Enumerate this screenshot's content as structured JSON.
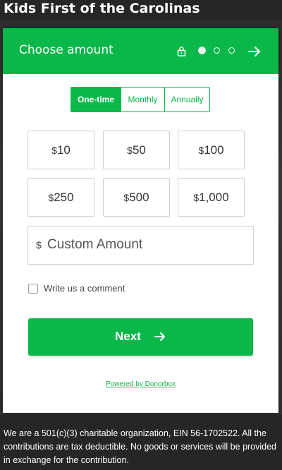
{
  "page": {
    "title": "Kids First of the Carolinas",
    "footer": "We are a 501(c)(3) charitable organization, EIN 56-1702522. All the contributions are tax deductible. No goods or services will be provided in exchange for the contribution."
  },
  "widget": {
    "header_title": "Choose amount",
    "steps_total": 3,
    "current_step": 1,
    "icons": {
      "lock": "lock-icon",
      "next": "arrow-right-icon"
    },
    "frequency": {
      "options": [
        "One-time",
        "Monthly",
        "Annually"
      ],
      "selected": "One-time"
    },
    "amounts": [
      {
        "currency": "$",
        "value": "10"
      },
      {
        "currency": "$",
        "value": "50"
      },
      {
        "currency": "$",
        "value": "100"
      },
      {
        "currency": "$",
        "value": "250"
      },
      {
        "currency": "$",
        "value": "500"
      },
      {
        "currency": "$",
        "value": "1,000"
      }
    ],
    "custom_amount": {
      "currency": "$",
      "placeholder": "Custom Amount",
      "value": ""
    },
    "comment_checkbox": {
      "label": "Write us a comment",
      "checked": false
    },
    "next_button_label": "Next",
    "powered_by": "Powered by Donorbox"
  },
  "colors": {
    "accent": "#0ab84a",
    "background": "#262626",
    "text_dark": "#333333"
  }
}
